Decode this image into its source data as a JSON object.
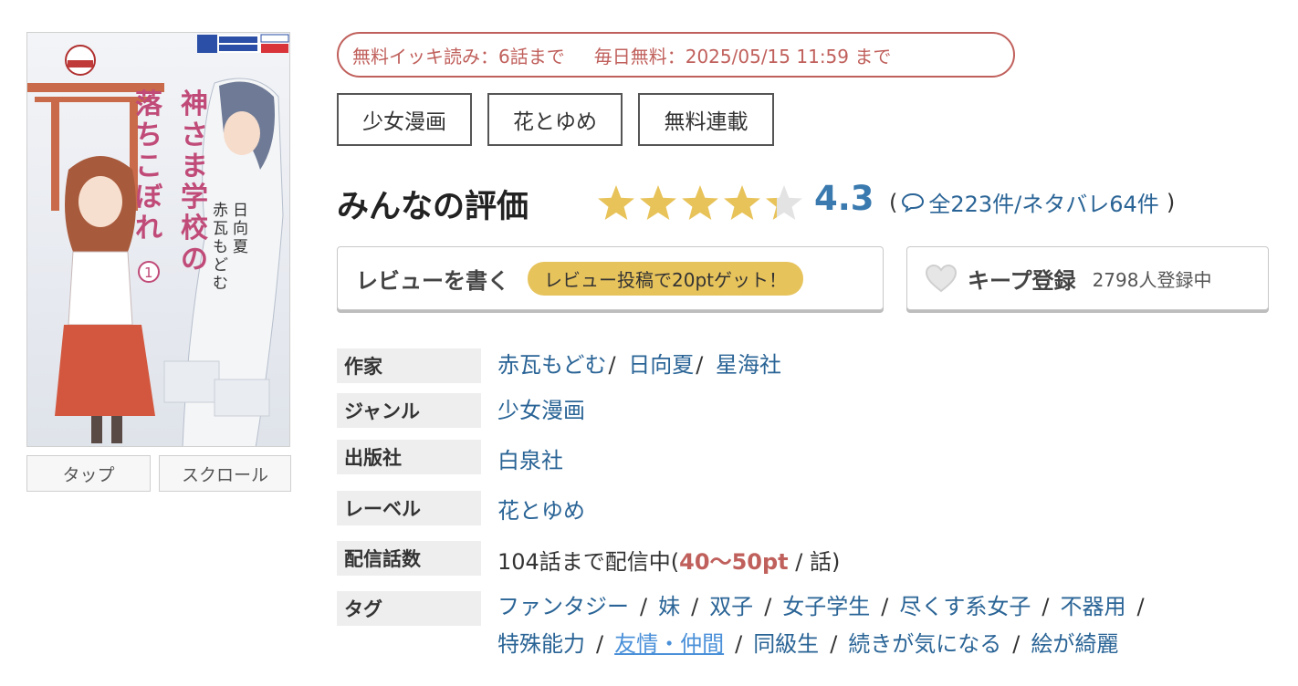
{
  "cover": {
    "title_lines": [
      "神さま学校の",
      "落ちこぼれ"
    ],
    "volume": "1",
    "author_vertical": "赤瓦もどむ",
    "original_vertical": "日向夏",
    "buttons": {
      "tap": "タップ",
      "scroll": "スクロール"
    }
  },
  "free": {
    "ikki": "無料イッキ読み：6話まで",
    "daily": "毎日無料：2025/05/15 11:59 まで"
  },
  "genres": [
    "少女漫画",
    "花とゆめ",
    "無料連載"
  ],
  "rating": {
    "title": "みんなの評価",
    "score": "4.3",
    "stars_value": 4.3,
    "star_color": "#e8c35a",
    "open_paren": "(",
    "reviews": "全223件/ネタバレ64件",
    "close_paren": ")"
  },
  "actions": {
    "review_label": "レビューを書く",
    "review_bonus": "レビュー投稿で20ptゲット！",
    "keep_label": "キープ登録",
    "keep_count": "2798人登録中"
  },
  "info": {
    "author_label": "作家",
    "authors": [
      "赤瓦もどむ",
      "日向夏",
      "星海社"
    ],
    "genre_label": "ジャンル",
    "genre": "少女漫画",
    "publisher_label": "出版社",
    "publisher": "白泉社",
    "label_label": "レーベル",
    "label": "花とゆめ",
    "episodes_label": "配信話数",
    "episodes_prefix": "104話まで配信中(",
    "episodes_pt": "40〜50pt",
    "episodes_suffix": " / 話)",
    "tags_label": "タグ",
    "tags_row1": [
      "ファンタジー",
      "妹",
      "双子",
      "女子学生",
      "尽くす系女子",
      "不器用"
    ],
    "tags_row2": [
      "特殊能力",
      "友情・仲間",
      "同級生",
      "続きが気になる",
      "絵が綺麗"
    ]
  }
}
